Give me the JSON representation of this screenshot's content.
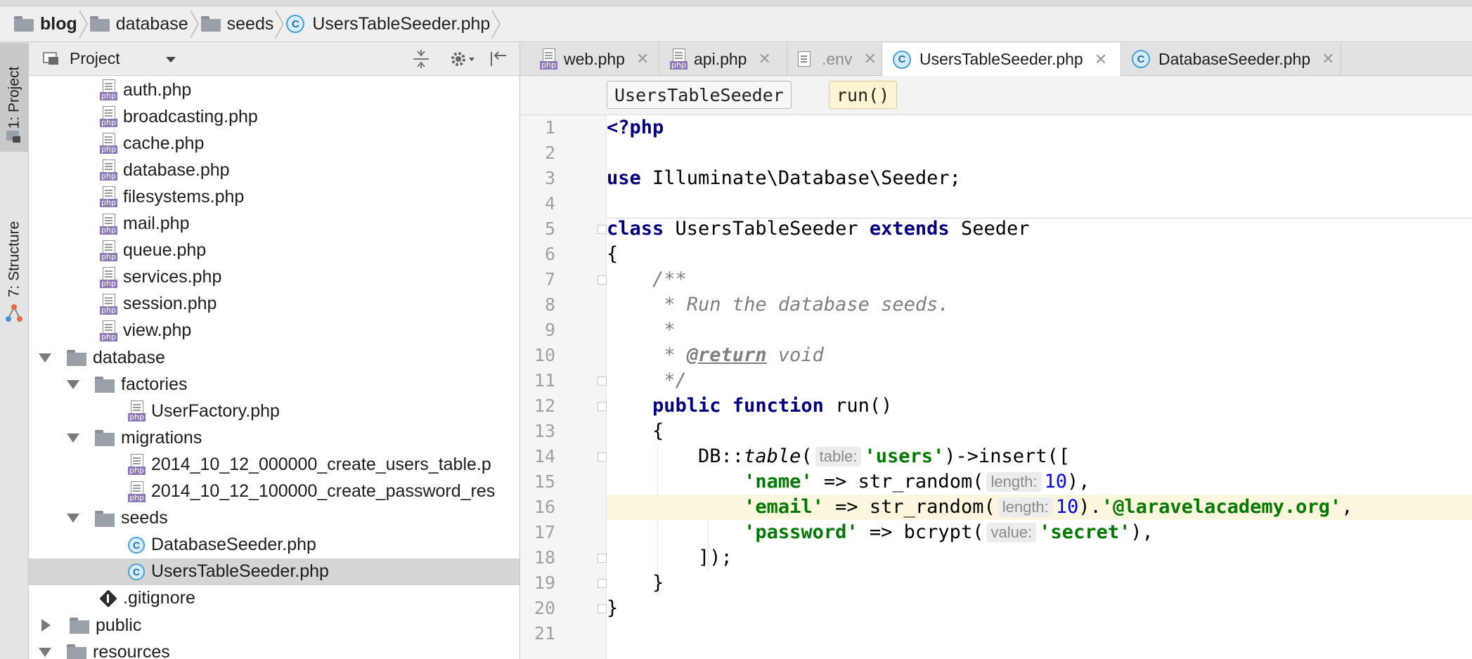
{
  "breadcrumb": [
    {
      "label": "blog",
      "type": "folder",
      "bold": true
    },
    {
      "label": "database",
      "type": "folder"
    },
    {
      "label": "seeds",
      "type": "folder"
    },
    {
      "label": "UsersTableSeeder.php",
      "type": "class-file"
    }
  ],
  "tool_stripe": {
    "project_tab": "1: Project",
    "structure_tab": "7: Structure"
  },
  "project_panel": {
    "title": "Project",
    "tree": [
      {
        "label": "auth.php",
        "kind": "php",
        "indent": 2
      },
      {
        "label": "broadcasting.php",
        "kind": "php",
        "indent": 2
      },
      {
        "label": "cache.php",
        "kind": "php",
        "indent": 2
      },
      {
        "label": "database.php",
        "kind": "php",
        "indent": 2
      },
      {
        "label": "filesystems.php",
        "kind": "php",
        "indent": 2
      },
      {
        "label": "mail.php",
        "kind": "php",
        "indent": 2
      },
      {
        "label": "queue.php",
        "kind": "php",
        "indent": 2
      },
      {
        "label": "services.php",
        "kind": "php",
        "indent": 2
      },
      {
        "label": "session.php",
        "kind": "php",
        "indent": 2
      },
      {
        "label": "view.php",
        "kind": "php",
        "indent": 2
      },
      {
        "label": "database",
        "kind": "folder-open",
        "indent": 0
      },
      {
        "label": "factories",
        "kind": "folder-open",
        "indent": 1
      },
      {
        "label": "UserFactory.php",
        "kind": "php",
        "indent": 3
      },
      {
        "label": "migrations",
        "kind": "folder-open",
        "indent": 1
      },
      {
        "label": "2014_10_12_000000_create_users_table.p",
        "kind": "php",
        "indent": 3
      },
      {
        "label": "2014_10_12_100000_create_password_res",
        "kind": "php",
        "indent": 3
      },
      {
        "label": "seeds",
        "kind": "folder-open",
        "indent": 1
      },
      {
        "label": "DatabaseSeeder.php",
        "kind": "class",
        "indent": 3
      },
      {
        "label": "UsersTableSeeder.php",
        "kind": "class",
        "indent": 3,
        "selected": true
      },
      {
        "label": ".gitignore",
        "kind": "git",
        "indent": 2
      },
      {
        "label": "public",
        "kind": "folder-closed",
        "indent": 0
      },
      {
        "label": "resources",
        "kind": "folder-open",
        "indent": 0
      }
    ]
  },
  "editor_tabs": [
    {
      "label": "web.php",
      "icon": "php-file-icon"
    },
    {
      "label": "api.php",
      "icon": "php-file-icon"
    },
    {
      "label": ".env",
      "icon": "text-file-icon",
      "dim": true
    },
    {
      "label": "UsersTableSeeder.php",
      "icon": "class-icon",
      "active": true
    },
    {
      "label": "DatabaseSeeder.php",
      "icon": "class-icon"
    }
  ],
  "code_breadcrumb": {
    "class_name": "UsersTableSeeder",
    "method": "run()"
  },
  "line_numbers": [
    "1",
    "2",
    "3",
    "4",
    "5",
    "6",
    "7",
    "8",
    "9",
    "10",
    "11",
    "12",
    "13",
    "14",
    "15",
    "16",
    "17",
    "18",
    "19",
    "20",
    "21"
  ],
  "code": {
    "l1": "<?php",
    "l3_kw": "use",
    "l3_rest": " Illuminate\\Database\\Seeder;",
    "l5_kw1": "class",
    "l5_name": " UsersTableSeeder ",
    "l5_kw2": "extends",
    "l5_rest": " Seeder",
    "l6": "{",
    "l7": "    /**",
    "l8": "     * Run the database seeds.",
    "l9": "     *",
    "l10_a": "     * ",
    "l10_tag": "@return",
    "l10_b": " void",
    "l11": "     */",
    "l12_kw1": "public",
    "l12_kw2": "function",
    "l12_rest": " run()",
    "l13": "    {",
    "l14_a": "        DB::",
    "l14_fn": "table",
    "l14_b": "(",
    "l14_hint": "table:",
    "l14_str": "'users'",
    "l14_c": ")->insert([",
    "l15_str": "'name'",
    "l15_a": " => str_random(",
    "l15_hint": "length:",
    "l15_num": "10",
    "l15_b": "),",
    "l16_str": "'email'",
    "l16_a": " => str_random(",
    "l16_hint": "length:",
    "l16_num": "10",
    "l16_b": ").",
    "l16_str2": "'@laravelacademy.org'",
    "l16_c": ",",
    "l17_str": "'password'",
    "l17_a": " => bcrypt(",
    "l17_hint": "value:",
    "l17_str2": "'secret'",
    "l17_b": "),",
    "l18": "        ]);",
    "l19": "    }",
    "l20": "}"
  },
  "colors": {
    "keyword": "#000080",
    "string": "#007a00",
    "number": "#0000ff",
    "comment": "#808080",
    "current_line": "#fbf6dc",
    "selection": "#d5d5d5"
  }
}
